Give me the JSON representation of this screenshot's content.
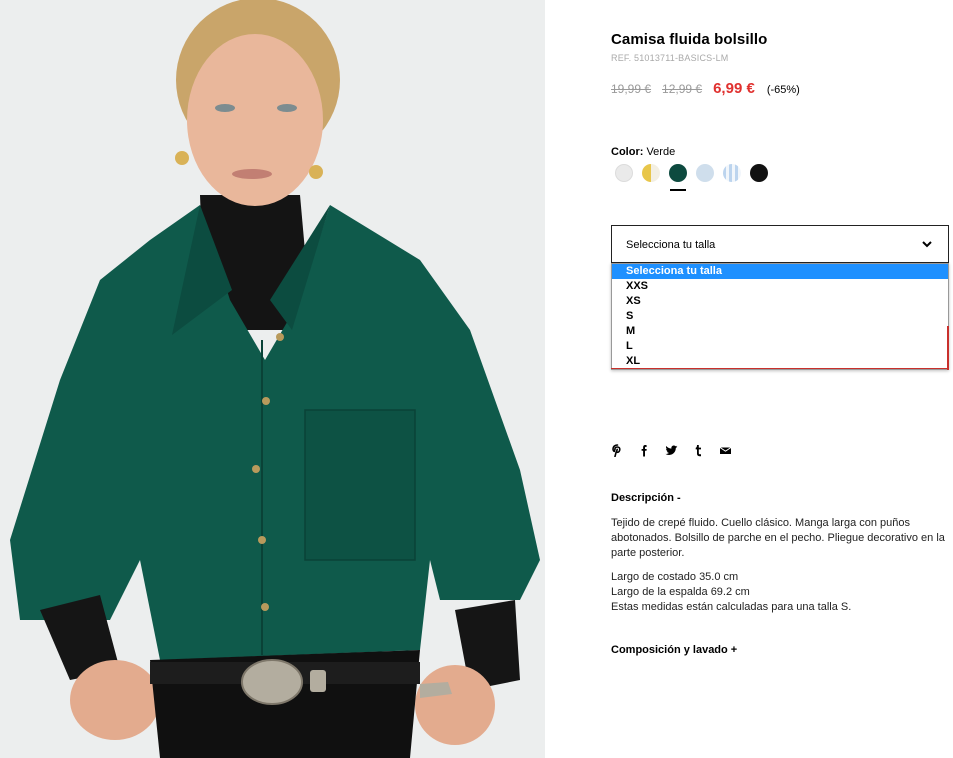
{
  "product": {
    "title": "Camisa fluida bolsillo",
    "ref": "REF. 51013711-BASICS-LM",
    "old_price_1": "19,99 €",
    "old_price_2": "12,99 €",
    "price": "6,99 €",
    "discount": "(-65%)"
  },
  "color": {
    "label": "Color:",
    "value": "Verde",
    "swatches": [
      {
        "name": "white",
        "fill": "#e8e8e8"
      },
      {
        "name": "yellow-stripe",
        "fill": "#e8c64a"
      },
      {
        "name": "green",
        "fill": "#0d4a3f"
      },
      {
        "name": "light-blue",
        "fill": "#c9daea"
      },
      {
        "name": "blue-stripe",
        "fill": "#bcd4ee"
      },
      {
        "name": "black",
        "fill": "#111111"
      }
    ],
    "selected_index": 2
  },
  "size": {
    "placeholder": "Selecciona tu talla",
    "options": [
      "Selecciona tu talla",
      "XXS",
      "XS",
      "S",
      "M",
      "L",
      "XL"
    ],
    "highlighted_index": 0
  },
  "share": {
    "icons": [
      "pinterest-icon",
      "facebook-icon",
      "twitter-icon",
      "tumblr-icon",
      "email-icon"
    ]
  },
  "description": {
    "heading": "Descripción -",
    "paragraph1": "Tejido de crepé fluido. Cuello clásico. Manga larga con puños abotonados. Bolsillo de parche en el pecho. Pliegue decorativo en la parte posterior.",
    "line1": "Largo de costado 35.0 cm",
    "line2": "Largo de la espalda 69.2 cm",
    "line3": "Estas medidas están calculadas para una talla S."
  },
  "composition": {
    "heading": "Composición y lavado +"
  },
  "colors": {
    "sale": "#e0312f",
    "highlight": "#1e90ff",
    "shirt": "#0f5a4b"
  }
}
